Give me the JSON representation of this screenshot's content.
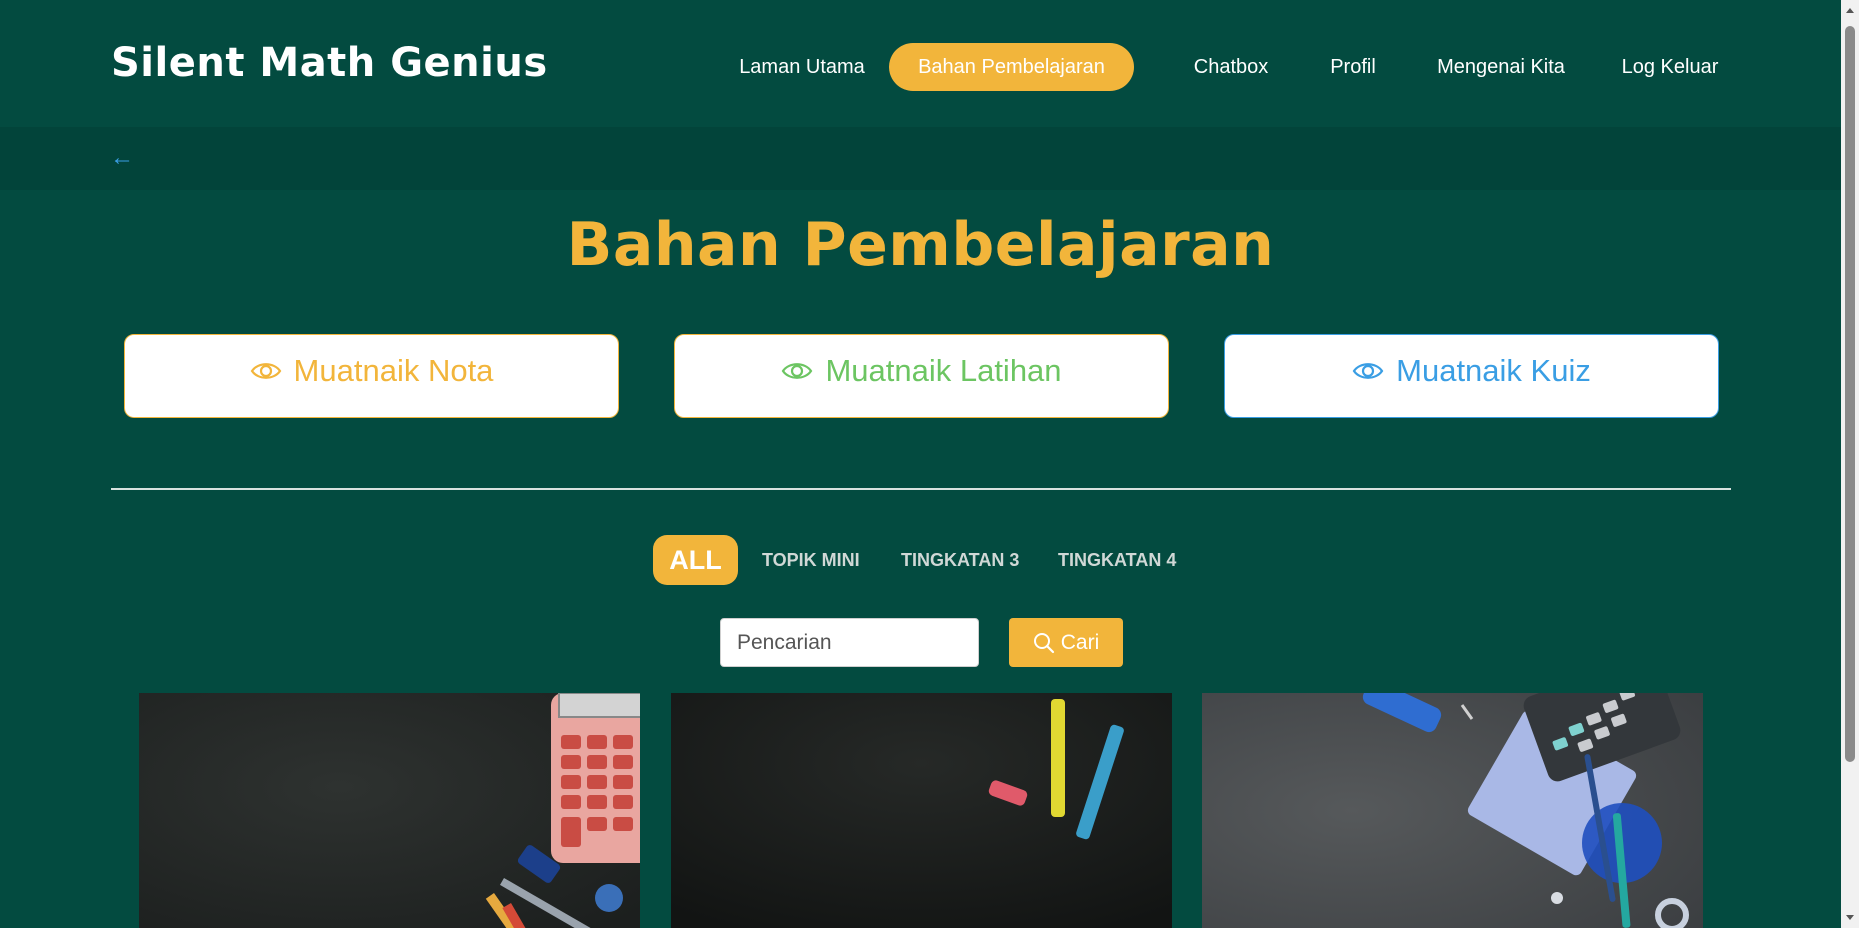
{
  "brand": "Silent Math Genius",
  "nav": {
    "items": [
      {
        "label": "Laman Utama"
      },
      {
        "label": "Bahan Pembelajaran"
      },
      {
        "label": "Chatbox"
      },
      {
        "label": "Profil"
      },
      {
        "label": "Mengenai Kita"
      },
      {
        "label": "Log Keluar"
      }
    ],
    "active": "Bahan Pembelajaran"
  },
  "back": {
    "icon": "arrow-left-icon",
    "glyph": "←"
  },
  "page_title": "Bahan Pembelajaran",
  "upload_buttons": [
    {
      "label": "Muatnaik Nota",
      "icon": "eye-icon",
      "color": "#f2b53b"
    },
    {
      "label": "Muatnaik Latihan",
      "icon": "eye-icon",
      "color": "#6cc562"
    },
    {
      "label": "Muatnaik Kuiz",
      "icon": "eye-icon",
      "color": "#3a9ee4"
    }
  ],
  "filters": {
    "items": [
      {
        "label": "ALL"
      },
      {
        "label": "TOPIK MINI"
      },
      {
        "label": "TINGKATAN 3"
      },
      {
        "label": "TINGKATAN 4"
      }
    ],
    "active": "ALL"
  },
  "search": {
    "placeholder": "Pencarian",
    "value": "",
    "button_label": "Cari",
    "icon": "search-icon"
  },
  "colors": {
    "background": "#034b40",
    "accent": "#f2b53b",
    "green": "#6cc562",
    "blue": "#3a9ee4"
  },
  "cards": [
    {
      "image": "blackboard-calculator-image"
    },
    {
      "image": "blackboard-chalk-image"
    },
    {
      "image": "desk-calculator-notebook-image"
    }
  ]
}
